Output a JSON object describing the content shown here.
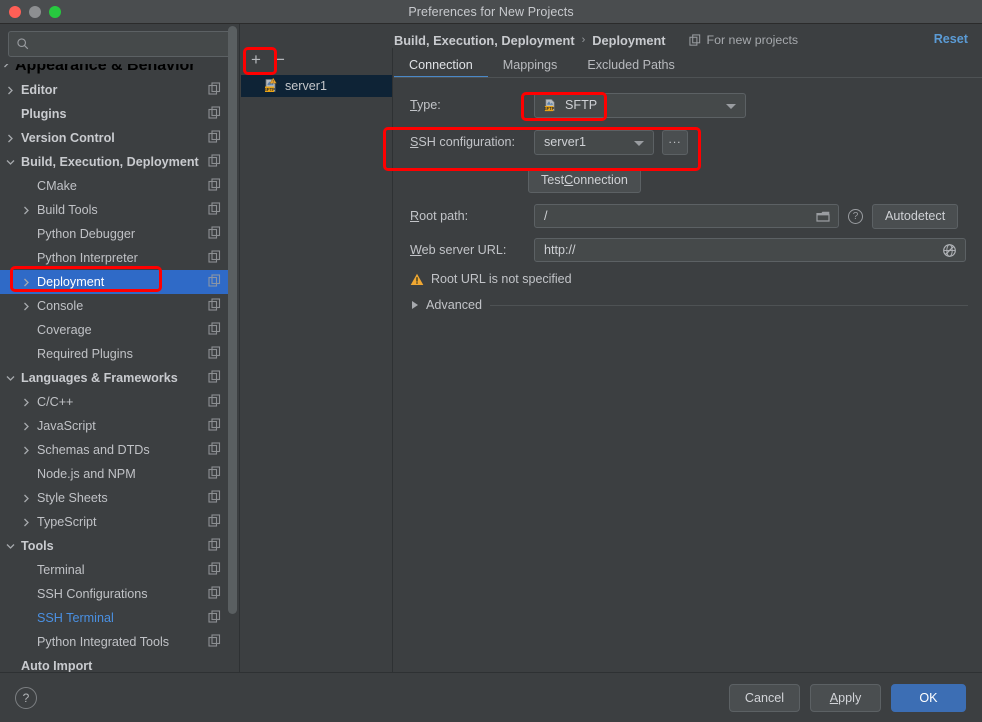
{
  "window": {
    "title": "Preferences for New Projects",
    "traffic_lights": [
      "close",
      "minimize",
      "maximize"
    ]
  },
  "sidebar": {
    "search": {
      "value": "",
      "placeholder": ""
    },
    "clipped_top_item": {
      "label": "Appearance & Behavior"
    },
    "items": [
      {
        "label": "Editor",
        "arrow": "right",
        "bold": true,
        "indent": 0,
        "copy": true
      },
      {
        "label": "Plugins",
        "arrow": "none",
        "bold": true,
        "indent": 0,
        "copy": true
      },
      {
        "label": "Version Control",
        "arrow": "right",
        "bold": true,
        "indent": 0,
        "copy": true
      },
      {
        "label": "Build, Execution, Deployment",
        "arrow": "down",
        "bold": true,
        "indent": 0,
        "copy": true
      },
      {
        "label": "CMake",
        "arrow": "none",
        "bold": false,
        "indent": 1,
        "copy": true
      },
      {
        "label": "Build Tools",
        "arrow": "right",
        "bold": false,
        "indent": 1,
        "copy": true
      },
      {
        "label": "Python Debugger",
        "arrow": "none",
        "bold": false,
        "indent": 1,
        "copy": true
      },
      {
        "label": "Python Interpreter",
        "arrow": "none",
        "bold": false,
        "indent": 1,
        "copy": true
      },
      {
        "label": "Deployment",
        "arrow": "right",
        "bold": false,
        "indent": 1,
        "copy": true,
        "selected": true
      },
      {
        "label": "Console",
        "arrow": "right",
        "bold": false,
        "indent": 1,
        "copy": true
      },
      {
        "label": "Coverage",
        "arrow": "none",
        "bold": false,
        "indent": 1,
        "copy": true
      },
      {
        "label": "Required Plugins",
        "arrow": "none",
        "bold": false,
        "indent": 1,
        "copy": true
      },
      {
        "label": "Languages & Frameworks",
        "arrow": "down",
        "bold": true,
        "indent": 0,
        "copy": true
      },
      {
        "label": "C/C++",
        "arrow": "right",
        "bold": false,
        "indent": 1,
        "copy": true
      },
      {
        "label": "JavaScript",
        "arrow": "right",
        "bold": false,
        "indent": 1,
        "copy": true
      },
      {
        "label": "Schemas and DTDs",
        "arrow": "right",
        "bold": false,
        "indent": 1,
        "copy": true
      },
      {
        "label": "Node.js and NPM",
        "arrow": "none",
        "bold": false,
        "indent": 1,
        "copy": true
      },
      {
        "label": "Style Sheets",
        "arrow": "right",
        "bold": false,
        "indent": 1,
        "copy": true
      },
      {
        "label": "TypeScript",
        "arrow": "right",
        "bold": false,
        "indent": 1,
        "copy": true
      },
      {
        "label": "Tools",
        "arrow": "down",
        "bold": true,
        "indent": 0,
        "copy": true
      },
      {
        "label": "Terminal",
        "arrow": "none",
        "bold": false,
        "indent": 1,
        "copy": true
      },
      {
        "label": "SSH Configurations",
        "arrow": "none",
        "bold": false,
        "indent": 1,
        "copy": true
      },
      {
        "label": "SSH Terminal",
        "arrow": "none",
        "bold": false,
        "indent": 1,
        "copy": true,
        "blue": true
      },
      {
        "label": "Python Integrated Tools",
        "arrow": "none",
        "bold": false,
        "indent": 1,
        "copy": true
      },
      {
        "label": "Auto Import",
        "arrow": "none",
        "bold": true,
        "indent": 0,
        "copy": false
      }
    ]
  },
  "server_pane": {
    "add_label": "+",
    "remove_label": "−",
    "items": [
      {
        "label": "server1",
        "icon": "sftp-warning-icon",
        "selected": true
      }
    ]
  },
  "content": {
    "breadcrumb": {
      "parent": "Build, Execution, Deployment",
      "separator": "›",
      "current": "Deployment",
      "scope": "For new projects"
    },
    "reset_label": "Reset",
    "tabs": [
      {
        "label": "Connection",
        "active": true
      },
      {
        "label": "Mappings",
        "active": false
      },
      {
        "label": "Excluded Paths",
        "active": false
      }
    ],
    "fields": {
      "type_label": "Type:",
      "type_value": "SFTP",
      "ssh_label": "SSH configuration:",
      "ssh_value": "server1",
      "ssh_browse_label": "...",
      "test_connection_label": "Test Connection",
      "root_path_label": "Root path:",
      "root_path_value": "/",
      "autodetect_label": "Autodetect",
      "help_label": "?",
      "web_url_label": "Web server URL:",
      "web_url_value": "http://",
      "warning_text": "Root URL is not specified",
      "advanced_label": "Advanced"
    }
  },
  "bottom_bar": {
    "help_label": "?",
    "cancel_label": "Cancel",
    "apply_label": "Apply",
    "ok_label": "OK"
  },
  "annotations": {
    "color": "#ff0000",
    "boxes": [
      "add-server-button",
      "deployment-tree-item",
      "type-sftp-value",
      "ssh-configuration-row"
    ]
  },
  "colors": {
    "accent_blue": "#2f6ac7",
    "link_blue": "#5b9bd5",
    "primary_button": "#3c6eb4",
    "warning_amber": "#f0a732",
    "window_bg": "#3c3f41",
    "selected_row_bg": "#0e2336"
  }
}
